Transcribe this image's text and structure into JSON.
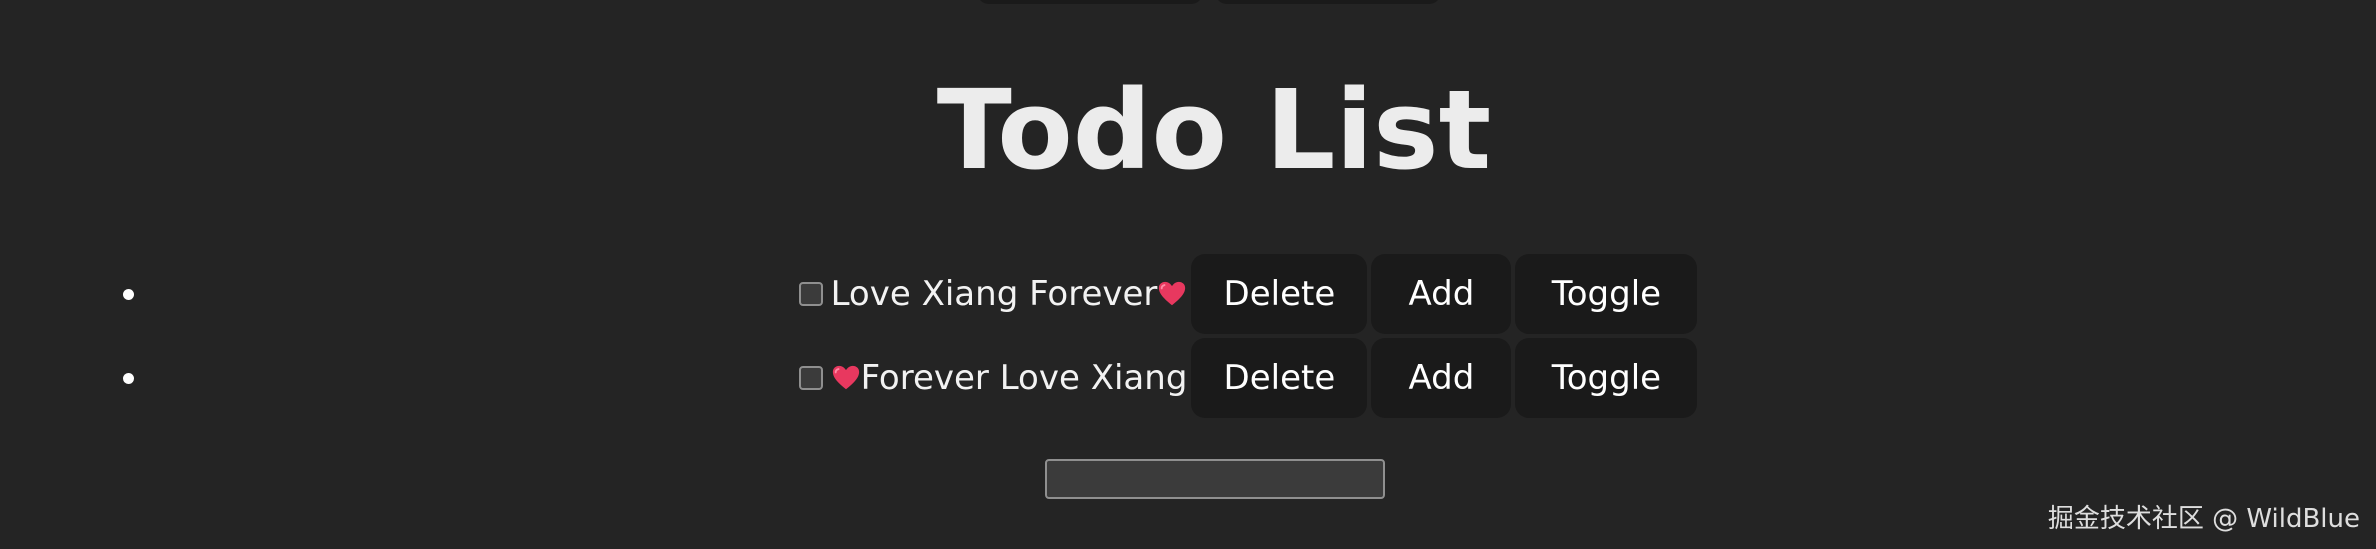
{
  "page": {
    "title": "Todo List"
  },
  "todos": [
    {
      "text_before": "",
      "text": "Love Xiang Forever",
      "emoji_position": "after",
      "emoji": "heart-icon",
      "checked": false
    },
    {
      "text_before": "",
      "text": "Forever Love Xiang",
      "emoji_position": "before",
      "emoji": "heart-icon",
      "checked": false
    }
  ],
  "actions": {
    "delete_label": "Delete",
    "add_label": "Add",
    "toggle_label": "Toggle"
  },
  "new_todo": {
    "value": "",
    "placeholder": ""
  },
  "watermark": {
    "text": "掘金技术社区 @ WildBlue"
  },
  "colors": {
    "background": "#242424",
    "button_bg": "#1a1a1a",
    "heart": "#e8385f"
  }
}
